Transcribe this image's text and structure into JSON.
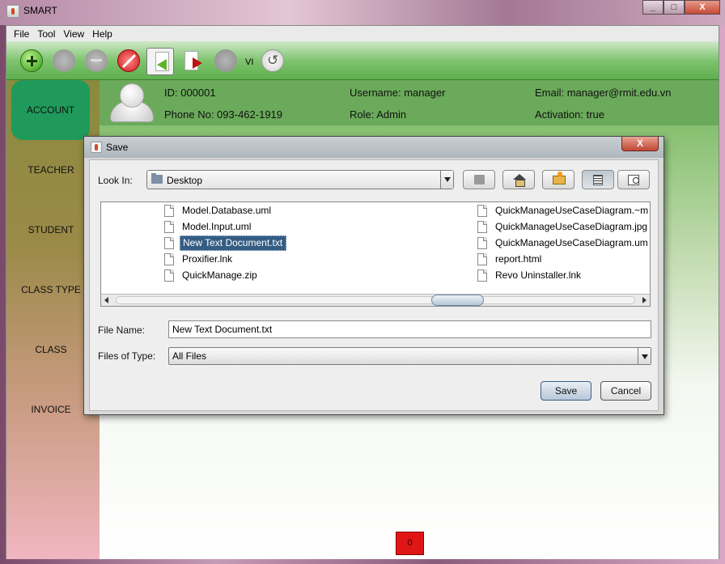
{
  "window": {
    "title": "SMART",
    "buttons": [
      "_",
      "□",
      "X"
    ]
  },
  "menu": [
    "File",
    "Tool",
    "View",
    "Help"
  ],
  "toolbar": {
    "lang_label": "VI"
  },
  "sidebar": {
    "items": [
      {
        "label": "ACCOUNT",
        "active": true
      },
      {
        "label": "TEACHER"
      },
      {
        "label": "STUDENT"
      },
      {
        "label": "CLASS TYPE"
      },
      {
        "label": "CLASS"
      },
      {
        "label": "INVOICE"
      }
    ]
  },
  "user": {
    "id": "ID: 000001",
    "phone": "Phone No: 093-462-1919",
    "username": "Username: manager",
    "role": "Role: Admin",
    "email": "Email: manager@rmit.edu.vn",
    "activation": "Activation: true"
  },
  "status": {
    "counter": "0"
  },
  "dialog": {
    "title": "Save",
    "close_label": "X",
    "look_in_label": "Look In:",
    "look_in_value": "Desktop",
    "files_left": [
      {
        "name": "Model.Database.uml"
      },
      {
        "name": "Model.Input.uml"
      },
      {
        "name": "New Text Document.txt",
        "selected": true
      },
      {
        "name": "Proxifier.lnk"
      },
      {
        "name": "QuickManage.zip"
      }
    ],
    "files_right": [
      {
        "name": "QuickManageUseCaseDiagram.~m"
      },
      {
        "name": "QuickManageUseCaseDiagram.jpg"
      },
      {
        "name": "QuickManageUseCaseDiagram.um"
      },
      {
        "name": "report.html"
      },
      {
        "name": "Revo Uninstaller.lnk"
      }
    ],
    "file_name_label": "File Name:",
    "file_name_value": "New Text Document.txt",
    "file_type_label": "Files of Type:",
    "file_type_value": "All Files",
    "save_label": "Save",
    "cancel_label": "Cancel"
  }
}
